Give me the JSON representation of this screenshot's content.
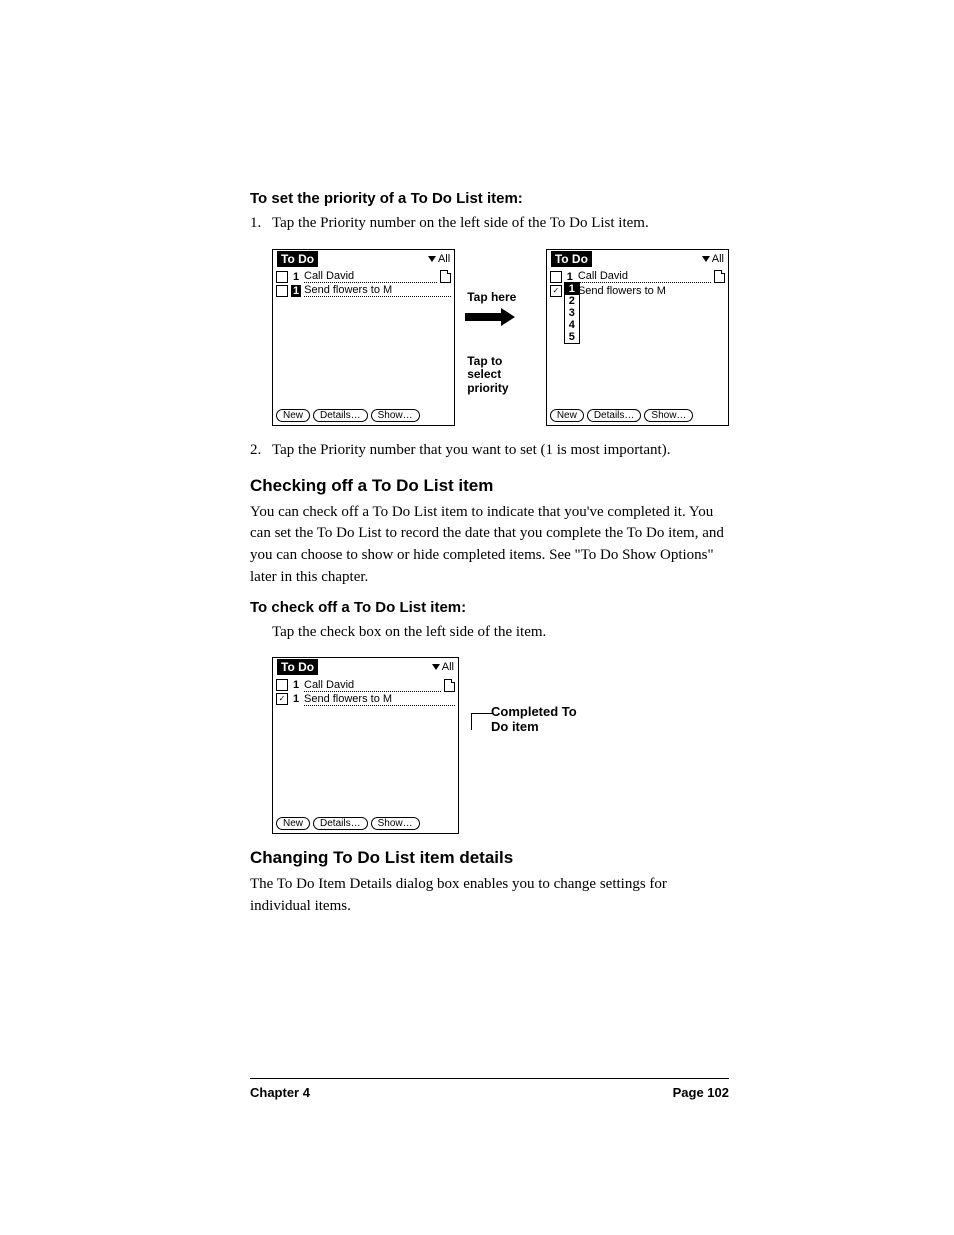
{
  "proc1": {
    "heading": "To set the priority of a To Do List item:",
    "step1_num": "1.",
    "step1_text": "Tap the Priority number on the left side of the To Do List item.",
    "step2_num": "2.",
    "step2_text": "Tap the Priority number that you want to set (1 is most important)."
  },
  "callouts": {
    "tap_here": "Tap here",
    "tap_select": "Tap to select priority",
    "completed": "Completed To Do item"
  },
  "palm": {
    "title": "To Do",
    "filter": "All",
    "items": [
      {
        "prio": "1",
        "text": "Call David",
        "checked": false,
        "note": true
      },
      {
        "prio": "1",
        "text": "Send flowers to M",
        "checked": false,
        "note": false
      }
    ],
    "buttons": {
      "new": "New",
      "details": "Details…",
      "show": "Show…"
    },
    "prio_options": [
      "1",
      "2",
      "3",
      "4",
      "5"
    ]
  },
  "section1": {
    "heading": "Checking off a To Do List item",
    "body": "You can check off a To Do List item to indicate that you've completed it. You can set the To Do List to record the date that you complete the To Do item, and you can choose to show or hide completed items. See \"To Do Show Options\" later in this chapter."
  },
  "proc2": {
    "heading": "To check off a To Do List item:",
    "step_text": "Tap the check box on the left side of the item."
  },
  "section2": {
    "heading": "Changing To Do List item details",
    "body": "The To Do Item Details dialog box enables you to change settings for individual items."
  },
  "footer": {
    "chapter": "Chapter 4",
    "page": "Page 102"
  }
}
